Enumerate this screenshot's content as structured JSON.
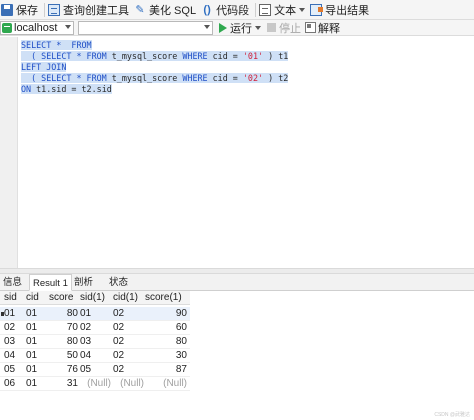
{
  "toolbar": {
    "save": "保存",
    "query_builder": "查询创建工具",
    "beautify_sql": "美化 SQL",
    "code_snippet": "代码段",
    "text": "文本",
    "export_result": "导出结果"
  },
  "connection": {
    "selected": "localhost",
    "database": ""
  },
  "actions": {
    "run": "运行",
    "stop": "停止",
    "explain": "解释"
  },
  "editor": {
    "lines": [
      [
        {
          "t": "SELECT * ",
          "c": "kw"
        },
        {
          "t": " FROM",
          "c": "kw"
        }
      ],
      [
        {
          "t": "  ( SELECT * FROM ",
          "c": "kw"
        },
        {
          "t": "t_mysql_score ",
          "c": "id"
        },
        {
          "t": "WHERE ",
          "c": "kw"
        },
        {
          "t": "cid = ",
          "c": "id"
        },
        {
          "t": "'01'",
          "c": "str"
        },
        {
          "t": " ) t1",
          "c": "id"
        }
      ],
      [
        {
          "t": "LEFT JOIN",
          "c": "kw"
        }
      ],
      [
        {
          "t": "  ( SELECT * FROM ",
          "c": "kw"
        },
        {
          "t": "t_mysql_score ",
          "c": "id"
        },
        {
          "t": "WHERE ",
          "c": "kw"
        },
        {
          "t": "cid = ",
          "c": "id"
        },
        {
          "t": "'02'",
          "c": "str"
        },
        {
          "t": " ) t2",
          "c": "id"
        }
      ],
      [
        {
          "t": "ON ",
          "c": "kw"
        },
        {
          "t": "t1.sid = t2.sid",
          "c": "id"
        }
      ]
    ]
  },
  "result_tabs": [
    "信息",
    "Result 1",
    "剖析",
    "状态"
  ],
  "result": {
    "columns": [
      "sid",
      "cid",
      "score",
      "sid(1)",
      "cid(1)",
      "score(1)"
    ],
    "null_label": "(Null)",
    "rows": [
      [
        "01",
        "01",
        "80",
        "01",
        "02",
        "90"
      ],
      [
        "02",
        "01",
        "70",
        "02",
        "02",
        "60"
      ],
      [
        "03",
        "01",
        "80",
        "03",
        "02",
        "80"
      ],
      [
        "04",
        "01",
        "50",
        "04",
        "02",
        "30"
      ],
      [
        "05",
        "01",
        "76",
        "05",
        "02",
        "87"
      ],
      [
        "06",
        "01",
        "31",
        "(Null)",
        "(Null)",
        "(Null)"
      ]
    ]
  },
  "watermark": "CSDN @武雅达"
}
